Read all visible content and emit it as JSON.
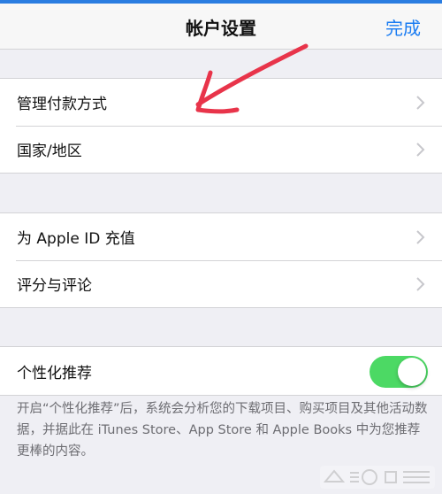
{
  "navbar": {
    "title": "帐户设置",
    "done_label": "完成"
  },
  "group1": {
    "items": [
      {
        "label": "管理付款方式"
      },
      {
        "label": "国家/地区"
      }
    ]
  },
  "group2": {
    "items": [
      {
        "label": "为 Apple ID 充值"
      },
      {
        "label": "评分与评论"
      }
    ]
  },
  "group3": {
    "personalized": {
      "label": "个性化推荐",
      "enabled": true
    }
  },
  "footer": {
    "text": "开启“个性化推荐”后，系统会分析您的下载项目、购买项目及其他活动数据，并据此在 iTunes Store、App Store 和 Apple Books 中为您推荐更棒的内容。"
  },
  "colors": {
    "accent": "#1a7cf2",
    "toggle_on": "#4cd964",
    "annotation": "#e8344a"
  },
  "icons": {
    "row_chevron": "chevron-right-icon",
    "annotation": "red-arrow-annotation"
  }
}
